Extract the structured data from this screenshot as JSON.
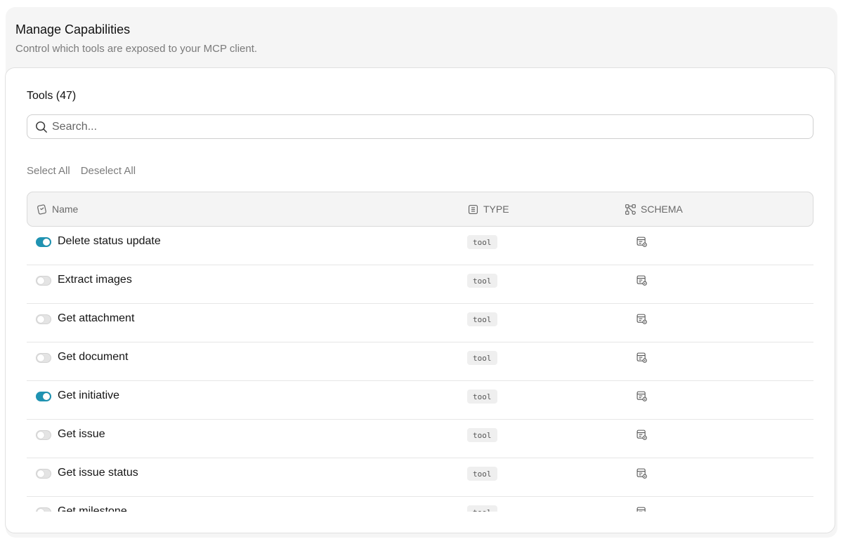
{
  "header": {
    "title": "Manage Capabilities",
    "subtitle": "Control which tools are exposed to your MCP client."
  },
  "tools": {
    "count_label": "Tools (47)",
    "search_placeholder": "Search...",
    "select_all": "Select All",
    "deselect_all": "Deselect All"
  },
  "columns": {
    "name": "Name",
    "type": "TYPE",
    "schema": "SCHEMA"
  },
  "colors": {
    "toggle_on": "#1f93b2",
    "toggle_off": "#e4e4e4"
  },
  "rows": [
    {
      "name": "Delete status update",
      "type": "tool",
      "enabled": true
    },
    {
      "name": "Extract images",
      "type": "tool",
      "enabled": false
    },
    {
      "name": "Get attachment",
      "type": "tool",
      "enabled": false
    },
    {
      "name": "Get document",
      "type": "tool",
      "enabled": false
    },
    {
      "name": "Get initiative",
      "type": "tool",
      "enabled": true
    },
    {
      "name": "Get issue",
      "type": "tool",
      "enabled": false
    },
    {
      "name": "Get issue status",
      "type": "tool",
      "enabled": false
    },
    {
      "name": "Get milestone",
      "type": "tool",
      "enabled": false
    }
  ]
}
